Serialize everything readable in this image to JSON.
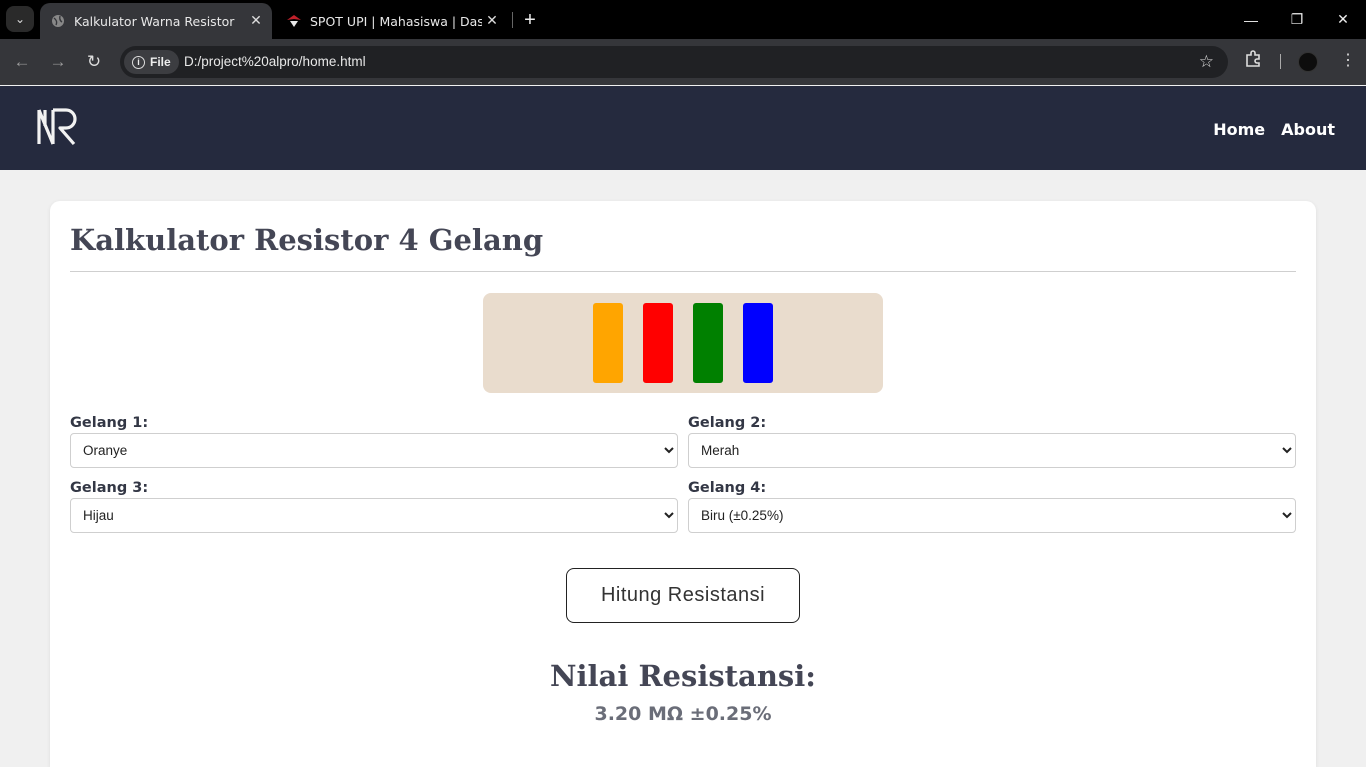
{
  "browser": {
    "tabs": [
      {
        "title": "Kalkulator Warna Resistor",
        "active": true
      },
      {
        "title": "SPOT UPI | Mahasiswa | Dashboard",
        "active": false
      }
    ],
    "address": {
      "scheme_label": "File",
      "url": "D:/project%20alpro/home.html"
    }
  },
  "nav": {
    "logo_text": "R",
    "links": [
      "Home",
      "About"
    ]
  },
  "calculator": {
    "title": "Kalkulator Resistor 4 Gelang",
    "bands": [
      {
        "label": "Gelang 1:",
        "value": "Oranye",
        "color": "#ffa500"
      },
      {
        "label": "Gelang 2:",
        "value": "Merah",
        "color": "#ff0000"
      },
      {
        "label": "Gelang 3:",
        "value": "Hijau",
        "color": "#008000"
      },
      {
        "label": "Gelang 4:",
        "value": "Biru (±0.25%)",
        "color": "#0000ff"
      }
    ],
    "button_label": "Hitung Resistansi",
    "result_title": "Nilai Resistansi:",
    "result_value": "3.20 MΩ ±0.25%"
  },
  "colors": {
    "navbar": "#252a3e",
    "resistor_body": "#e9dccd"
  }
}
